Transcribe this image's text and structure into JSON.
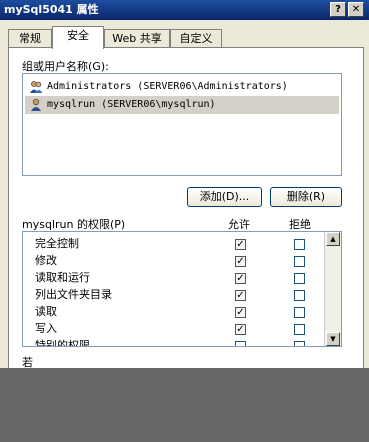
{
  "window": {
    "title": "mySql5041 属性"
  },
  "title_buttons": {
    "help": "?",
    "close": "✕"
  },
  "tabs": [
    {
      "label": "常规"
    },
    {
      "label": "安全"
    },
    {
      "label": "Web 共享"
    },
    {
      "label": "自定义"
    }
  ],
  "groups_label": "组或用户名称(G):",
  "users": [
    {
      "name": "Administrators (SERVER06\\Administrators)",
      "icon": "user-group-icon",
      "selected": false
    },
    {
      "name": "mysqlrun (SERVER06\\mysqlrun)",
      "icon": "user-icon",
      "selected": true
    }
  ],
  "buttons": {
    "add": "添加(D)...",
    "remove": "删除(R)"
  },
  "permissions": {
    "label": "mysqlrun 的权限(P)",
    "allow_header": "允许",
    "deny_header": "拒绝",
    "rows": [
      {
        "name": "完全控制",
        "allow": true,
        "deny": false
      },
      {
        "name": "修改",
        "allow": true,
        "deny": false
      },
      {
        "name": "读取和运行",
        "allow": true,
        "deny": false
      },
      {
        "name": "列出文件夹目录",
        "allow": true,
        "deny": false
      },
      {
        "name": "读取",
        "allow": true,
        "deny": false
      },
      {
        "name": "写入",
        "allow": true,
        "deny": false
      },
      {
        "name": "特别的权限",
        "allow": false,
        "deny": false
      }
    ]
  },
  "scroll": {
    "up": "▲",
    "down": "▼"
  },
  "check_mark": "✓",
  "advanced_hint": "若"
}
